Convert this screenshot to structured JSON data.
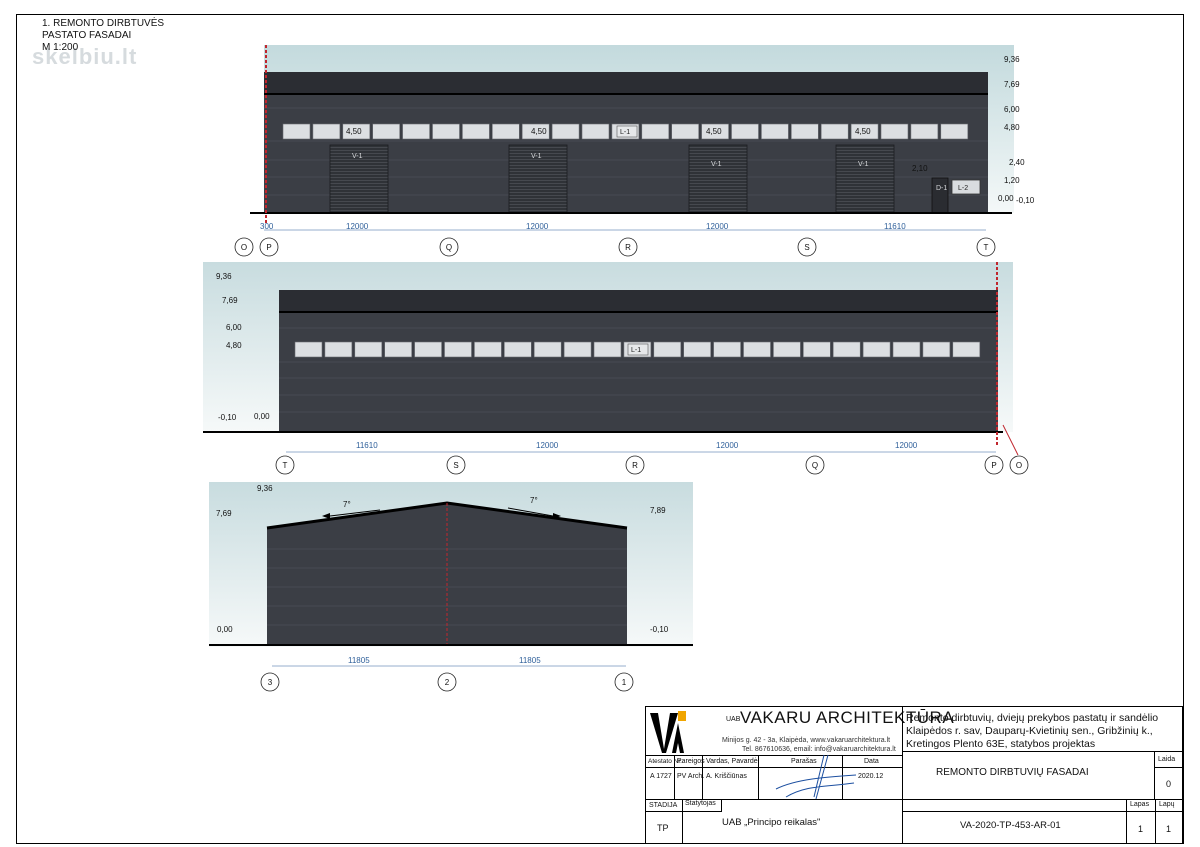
{
  "drawing": {
    "title_lines": [
      "1. REMONTO DIRBTUVĖS",
      "PASTATO FASADAI",
      "M 1:200"
    ],
    "watermark": "skelbiu.lt"
  },
  "facade1": {
    "levels": [
      "9,36",
      "7,69",
      "6,00",
      "4,80",
      "2,40",
      "1,20",
      "0,00",
      "-0,10"
    ],
    "door_level": "4,50",
    "door_label": "V-1",
    "window_label": "L-1",
    "door_small_level": "2,10",
    "small_door_label": "D-1",
    "small_window_label": "L-2",
    "dims": [
      "300",
      "12000",
      "12000",
      "12000",
      "11610"
    ],
    "axes": [
      "O",
      "P",
      "Q",
      "R",
      "S",
      "T"
    ]
  },
  "facade2": {
    "levels_left": [
      "9,36",
      "7,69",
      "6,00",
      "4,80",
      "-0,10",
      "0,00"
    ],
    "window_label": "L-1",
    "dims": [
      "11610",
      "12000",
      "12000",
      "12000"
    ],
    "axes": [
      "T",
      "S",
      "R",
      "Q",
      "P",
      "O"
    ]
  },
  "facade3": {
    "levels": [
      "9,36",
      "7,69",
      "7,89",
      "0,00",
      "-0,10"
    ],
    "slopes": [
      "7°",
      "7°"
    ],
    "dims": [
      "11805",
      "11805"
    ],
    "axes": [
      "3",
      "2",
      "1"
    ]
  },
  "titleblock": {
    "uab": "UAB",
    "company": "VAKARU ARCHITEKTŪRA",
    "address": "Minijos g. 42 - 3a, Klaipėda, www.vakaruarchitektura.lt",
    "contacts": "Tel. 867610636, email: info@vakaruarchitektura.lt",
    "project": [
      "Remonto dirbtuvių, dviejų prekybos pastatų ir sandėlio",
      "Klaipėdos r. sav, Dauparų-Kvietinių sen., Gribžinių k.,",
      "Kretingos Plento 63E, statybos projektas"
    ],
    "headers": {
      "cert": "Atestato Nr.",
      "role": "Pareigos",
      "name": "Vardas, Pavardė",
      "sign": "Parašas",
      "date": "Data"
    },
    "row": {
      "cert": "A 1727",
      "role": "PV Arch.",
      "name": "A. Kriščiūnas",
      "date": "2020.12"
    },
    "sheet_name": "REMONTO DIRBTUVIŲ FASADAI",
    "edition_label": "Laida",
    "edition": "0",
    "stage_label": "STADIJA",
    "builder_label": "Statytojas",
    "stage": "TP",
    "builder": "UAB „Principo reikalas\"",
    "code": "VA-2020-TP-453-AR-01",
    "sheet_label": "Lapas",
    "sheets_label": "Lapų",
    "sheet": "1",
    "sheets": "1"
  },
  "colors": {
    "wall": "#3b3e45",
    "roof": "#2a2c31",
    "sky_top": "#c8dde0",
    "sky_bottom": "#ffffff",
    "dim": "#2e5f9a",
    "axis_red": "#c0262d"
  }
}
